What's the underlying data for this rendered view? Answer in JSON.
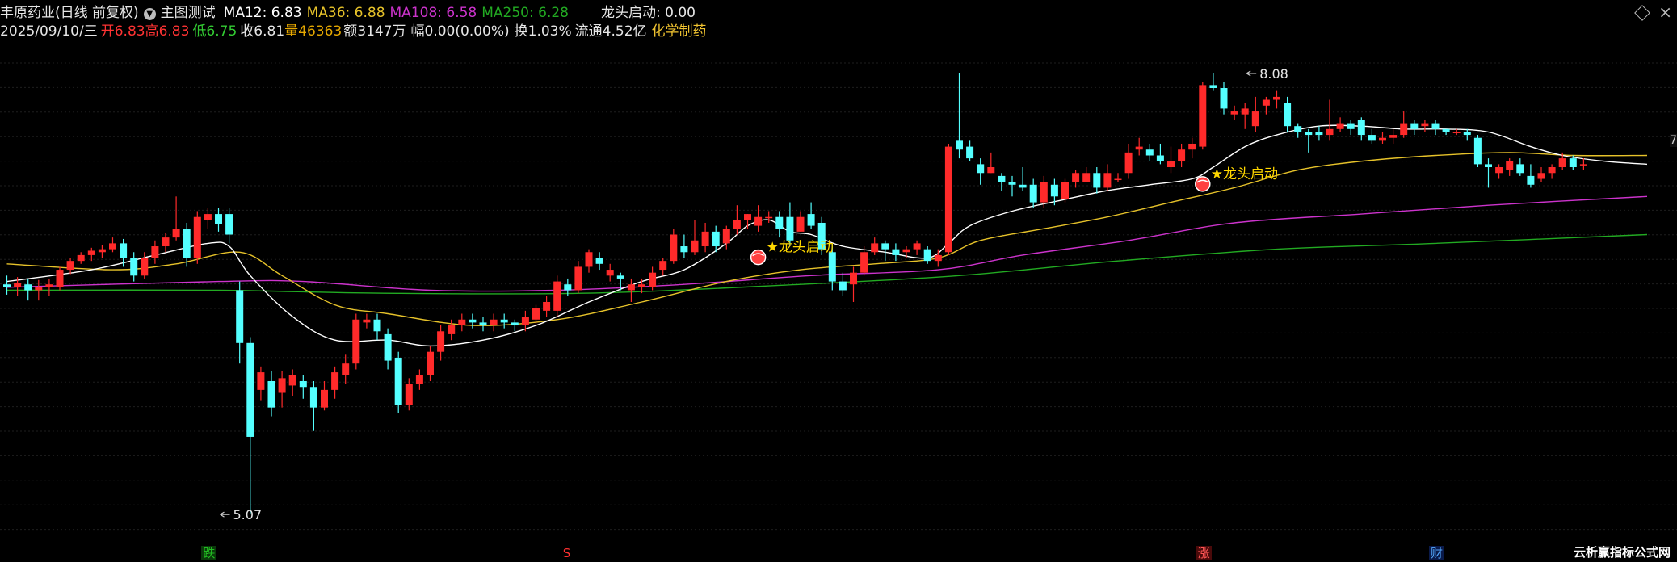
{
  "header": {
    "stock_title": "丰原药业(日线 前复权)",
    "indicator_name": "主图测试",
    "ma12": "MA12: 6.83",
    "ma36": "MA36: 6.88",
    "ma108": "MA108: 6.58",
    "ma250": "MA250: 6.28",
    "signal": "龙头启动: 0.00",
    "date": "2025/09/10/三",
    "open": "开6.83",
    "high": "高6.83",
    "low": "低6.75",
    "close": "收6.81",
    "volume": "量46363",
    "amount": "额3147万",
    "change": "幅0.00(0.00%)",
    "turnover": "换1.03%",
    "float": "流通4.52亿",
    "industry": "化学制药"
  },
  "edge_label": "7",
  "watermark": "云析赢指标公式网",
  "colors": {
    "up": "#ff2a2a",
    "down": "#54ffff",
    "ma12": "#ffffff",
    "ma36": "#e6c22a",
    "ma108": "#cc33cc",
    "ma250": "#22aa22",
    "signal": "#ffd700",
    "neutral": "#e6e6e6",
    "volume": "#e6a800",
    "industry": "#f0c330"
  },
  "chart_data": {
    "type": "candlestick",
    "y_range": [
      4.9,
      8.25
    ],
    "annotations": [
      {
        "text": "8.08",
        "x": 117,
        "y": 8.08
      },
      {
        "text": "5.07",
        "x": 20,
        "y": 5.07
      }
    ],
    "signals": [
      {
        "text": "★龙头启动",
        "x": 71,
        "y": 6.88
      },
      {
        "text": "★龙头启动",
        "x": 113,
        "y": 7.38
      }
    ],
    "bottom_tags": [
      {
        "text": "跌",
        "x": 19,
        "color": "#22bb22",
        "bg": "#0a3a0a"
      },
      {
        "text": "S",
        "x": 53,
        "color": "#ff3030",
        "bg": "#000000"
      },
      {
        "text": "涨",
        "x": 113,
        "color": "#ff5555",
        "bg": "#4a0a0a"
      },
      {
        "text": "财",
        "x": 135,
        "color": "#55aaff",
        "bg": "#0a1a4a"
      }
    ],
    "candles": [
      [
        6.64,
        6.62,
        6.7,
        6.57
      ],
      [
        6.62,
        6.65,
        6.69,
        6.56
      ],
      [
        6.64,
        6.6,
        6.68,
        6.53
      ],
      [
        6.6,
        6.62,
        6.67,
        6.53
      ],
      [
        6.62,
        6.64,
        6.68,
        6.56
      ],
      [
        6.62,
        6.74,
        6.76,
        6.6
      ],
      [
        6.74,
        6.8,
        6.82,
        6.71
      ],
      [
        6.8,
        6.84,
        6.86,
        6.78
      ],
      [
        6.84,
        6.87,
        6.89,
        6.8
      ],
      [
        6.86,
        6.88,
        6.91,
        6.82
      ],
      [
        6.88,
        6.92,
        6.96,
        6.86
      ],
      [
        6.92,
        6.82,
        6.95,
        6.76
      ],
      [
        6.82,
        6.7,
        6.86,
        6.66
      ],
      [
        6.7,
        6.82,
        6.86,
        6.68
      ],
      [
        6.82,
        6.9,
        6.94,
        6.78
      ],
      [
        6.9,
        6.96,
        6.99,
        6.86
      ],
      [
        6.96,
        7.02,
        7.24,
        6.94
      ],
      [
        7.02,
        6.82,
        7.06,
        6.76
      ],
      [
        6.82,
        7.1,
        7.14,
        6.78
      ],
      [
        7.08,
        7.12,
        7.16,
        7.02
      ],
      [
        7.12,
        7.05,
        7.16,
        7.0
      ],
      [
        7.12,
        6.98,
        7.16,
        6.92
      ],
      [
        6.6,
        6.24,
        6.66,
        6.1
      ],
      [
        6.24,
        5.6,
        6.28,
        5.07
      ],
      [
        5.92,
        6.04,
        6.08,
        5.85
      ],
      [
        5.98,
        5.8,
        6.05,
        5.74
      ],
      [
        5.9,
        6.0,
        6.05,
        5.8
      ],
      [
        5.95,
        6.02,
        6.06,
        5.88
      ],
      [
        5.98,
        5.94,
        6.02,
        5.86
      ],
      [
        5.94,
        5.8,
        5.98,
        5.64
      ],
      [
        5.8,
        5.92,
        5.98,
        5.78
      ],
      [
        5.92,
        6.04,
        6.08,
        5.86
      ],
      [
        6.02,
        6.1,
        6.16,
        5.96
      ],
      [
        6.1,
        6.4,
        6.44,
        6.06
      ],
      [
        6.38,
        6.4,
        6.44,
        6.34
      ],
      [
        6.4,
        6.32,
        6.44,
        6.26
      ],
      [
        6.3,
        6.12,
        6.34,
        6.06
      ],
      [
        6.14,
        5.82,
        6.18,
        5.76
      ],
      [
        5.82,
        5.96,
        6.0,
        5.78
      ],
      [
        5.96,
        6.02,
        6.06,
        5.92
      ],
      [
        6.02,
        6.18,
        6.22,
        5.98
      ],
      [
        6.18,
        6.32,
        6.36,
        6.12
      ],
      [
        6.3,
        6.36,
        6.4,
        6.26
      ],
      [
        6.36,
        6.4,
        6.44,
        6.32
      ],
      [
        6.4,
        6.38,
        6.44,
        6.34
      ],
      [
        6.38,
        6.36,
        6.42,
        6.32
      ],
      [
        6.36,
        6.4,
        6.44,
        6.32
      ],
      [
        6.4,
        6.38,
        6.44,
        6.34
      ],
      [
        6.38,
        6.36,
        6.4,
        6.32
      ],
      [
        6.36,
        6.42,
        6.46,
        6.32
      ],
      [
        6.4,
        6.48,
        6.5,
        6.36
      ],
      [
        6.46,
        6.52,
        6.56,
        6.42
      ],
      [
        6.46,
        6.66,
        6.7,
        6.42
      ],
      [
        6.64,
        6.6,
        6.68,
        6.56
      ],
      [
        6.6,
        6.76,
        6.8,
        6.58
      ],
      [
        6.76,
        6.86,
        6.88,
        6.72
      ],
      [
        6.82,
        6.78,
        6.86,
        6.74
      ],
      [
        6.7,
        6.74,
        6.78,
        6.66
      ],
      [
        6.7,
        6.68,
        6.72,
        6.6
      ],
      [
        6.6,
        6.64,
        6.68,
        6.52
      ],
      [
        6.62,
        6.64,
        6.68,
        6.58
      ],
      [
        6.62,
        6.72,
        6.76,
        6.6
      ],
      [
        6.74,
        6.8,
        6.82,
        6.7
      ],
      [
        6.8,
        6.98,
        7.02,
        6.78
      ],
      [
        6.9,
        6.86,
        6.98,
        6.82
      ],
      [
        6.86,
        6.94,
        7.08,
        6.84
      ],
      [
        6.9,
        7.0,
        7.06,
        6.86
      ],
      [
        7.0,
        6.9,
        7.04,
        6.86
      ],
      [
        6.92,
        7.02,
        7.04,
        6.88
      ],
      [
        7.02,
        7.08,
        7.18,
        6.98
      ],
      [
        7.08,
        7.12,
        7.12,
        7.02
      ],
      [
        7.04,
        7.1,
        7.18,
        7.0
      ],
      [
        7.1,
        7.1,
        7.14,
        7.06
      ],
      [
        7.1,
        7.02,
        7.14,
        6.96
      ],
      [
        7.1,
        6.94,
        7.2,
        6.9
      ],
      [
        7.0,
        7.1,
        7.14,
        7.0
      ],
      [
        7.12,
        7.04,
        7.2,
        7.02
      ],
      [
        7.06,
        6.88,
        7.1,
        6.84
      ],
      [
        6.86,
        6.66,
        6.92,
        6.6
      ],
      [
        6.66,
        6.6,
        6.72,
        6.56
      ],
      [
        6.64,
        6.72,
        6.76,
        6.52
      ],
      [
        6.72,
        6.86,
        6.9,
        6.7
      ],
      [
        6.86,
        6.92,
        6.96,
        6.84
      ],
      [
        6.92,
        6.88,
        6.94,
        6.8
      ],
      [
        6.88,
        6.84,
        6.92,
        6.8
      ],
      [
        6.86,
        6.88,
        6.9,
        6.82
      ],
      [
        6.88,
        6.92,
        6.94,
        6.84
      ],
      [
        6.88,
        6.8,
        6.9,
        6.78
      ],
      [
        6.8,
        6.84,
        6.88,
        6.76
      ],
      [
        6.86,
        7.58,
        7.6,
        6.84
      ],
      [
        7.62,
        7.56,
        8.08,
        7.5
      ],
      [
        7.58,
        7.5,
        7.62,
        7.48
      ],
      [
        7.46,
        7.4,
        7.5,
        7.32
      ],
      [
        7.4,
        7.44,
        7.54,
        7.4
      ],
      [
        7.38,
        7.34,
        7.4,
        7.28
      ],
      [
        7.34,
        7.32,
        7.38,
        7.24
      ],
      [
        7.32,
        7.3,
        7.44,
        7.28
      ],
      [
        7.32,
        7.2,
        7.36,
        7.16
      ],
      [
        7.2,
        7.34,
        7.38,
        7.16
      ],
      [
        7.32,
        7.24,
        7.36,
        7.18
      ],
      [
        7.22,
        7.34,
        7.36,
        7.2
      ],
      [
        7.34,
        7.4,
        7.42,
        7.3
      ],
      [
        7.34,
        7.4,
        7.44,
        7.34
      ],
      [
        7.4,
        7.3,
        7.44,
        7.26
      ],
      [
        7.3,
        7.4,
        7.46,
        7.28
      ],
      [
        7.36,
        7.36,
        7.4,
        7.34
      ],
      [
        7.4,
        7.54,
        7.6,
        7.36
      ],
      [
        7.56,
        7.58,
        7.64,
        7.52
      ],
      [
        7.56,
        7.52,
        7.6,
        7.48
      ],
      [
        7.52,
        7.48,
        7.6,
        7.46
      ],
      [
        7.44,
        7.48,
        7.58,
        7.4
      ],
      [
        7.48,
        7.56,
        7.6,
        7.44
      ],
      [
        7.56,
        7.6,
        7.64,
        7.5
      ],
      [
        7.58,
        8.0,
        8.02,
        7.56
      ],
      [
        8.0,
        7.98,
        8.08,
        7.96
      ],
      [
        7.98,
        7.84,
        8.02,
        7.8
      ],
      [
        7.8,
        7.82,
        7.86,
        7.76
      ],
      [
        7.8,
        7.84,
        7.88,
        7.7
      ],
      [
        7.72,
        7.82,
        7.92,
        7.68
      ],
      [
        7.86,
        7.9,
        7.92,
        7.8
      ],
      [
        7.9,
        7.92,
        7.96,
        7.84
      ],
      [
        7.88,
        7.72,
        7.92,
        7.68
      ],
      [
        7.72,
        7.68,
        7.74,
        7.64
      ],
      [
        7.68,
        7.66,
        7.7,
        7.54
      ],
      [
        7.68,
        7.66,
        7.72,
        7.62
      ],
      [
        7.66,
        7.7,
        7.9,
        7.62
      ],
      [
        7.7,
        7.74,
        7.78,
        7.68
      ],
      [
        7.74,
        7.7,
        7.76,
        7.66
      ],
      [
        7.76,
        7.66,
        7.78,
        7.62
      ],
      [
        7.66,
        7.62,
        7.7,
        7.6
      ],
      [
        7.62,
        7.64,
        7.68,
        7.6
      ],
      [
        7.64,
        7.66,
        7.7,
        7.6
      ],
      [
        7.66,
        7.74,
        7.82,
        7.64
      ],
      [
        7.74,
        7.7,
        7.76,
        7.66
      ],
      [
        7.72,
        7.74,
        7.76,
        7.68
      ],
      [
        7.74,
        7.7,
        7.76,
        7.66
      ],
      [
        7.7,
        7.68,
        7.7,
        7.66
      ],
      [
        7.68,
        7.68,
        7.7,
        7.66
      ],
      [
        7.68,
        7.66,
        7.7,
        7.62
      ],
      [
        7.64,
        7.46,
        7.66,
        7.44
      ],
      [
        7.46,
        7.44,
        7.5,
        7.3
      ],
      [
        7.4,
        7.44,
        7.46,
        7.36
      ],
      [
        7.42,
        7.48,
        7.5,
        7.38
      ],
      [
        7.46,
        7.4,
        7.5,
        7.38
      ],
      [
        7.38,
        7.32,
        7.46,
        7.3
      ],
      [
        7.36,
        7.4,
        7.44,
        7.34
      ],
      [
        7.4,
        7.44,
        7.46,
        7.36
      ],
      [
        7.44,
        7.5,
        7.54,
        7.42
      ],
      [
        7.5,
        7.44,
        7.52,
        7.42
      ],
      [
        7.46,
        7.46,
        7.5,
        7.42
      ]
    ],
    "ma12_knots": [
      [
        0,
        6.66
      ],
      [
        8,
        6.74
      ],
      [
        14,
        6.84
      ],
      [
        19,
        6.92
      ],
      [
        21,
        6.9
      ],
      [
        23,
        6.7
      ],
      [
        27,
        6.42
      ],
      [
        31,
        6.26
      ],
      [
        36,
        6.26
      ],
      [
        40,
        6.22
      ],
      [
        45,
        6.26
      ],
      [
        50,
        6.36
      ],
      [
        55,
        6.52
      ],
      [
        60,
        6.66
      ],
      [
        64,
        6.74
      ],
      [
        68,
        6.92
      ],
      [
        70,
        7.04
      ],
      [
        72,
        7.08
      ],
      [
        74,
        7.0
      ],
      [
        76,
        6.98
      ],
      [
        79,
        6.9
      ],
      [
        83,
        6.86
      ],
      [
        87,
        6.82
      ],
      [
        89,
        6.92
      ],
      [
        91,
        7.04
      ],
      [
        95,
        7.14
      ],
      [
        100,
        7.22
      ],
      [
        104,
        7.28
      ],
      [
        108,
        7.32
      ],
      [
        112,
        7.36
      ],
      [
        114,
        7.44
      ],
      [
        117,
        7.58
      ],
      [
        120,
        7.66
      ],
      [
        124,
        7.72
      ],
      [
        128,
        7.72
      ],
      [
        132,
        7.7
      ],
      [
        136,
        7.7
      ],
      [
        140,
        7.68
      ],
      [
        144,
        7.58
      ],
      [
        147,
        7.52
      ],
      [
        151,
        7.48
      ],
      [
        155,
        7.46
      ]
    ],
    "ma36_knots": [
      [
        0,
        6.78
      ],
      [
        10,
        6.74
      ],
      [
        16,
        6.78
      ],
      [
        22,
        6.86
      ],
      [
        26,
        6.7
      ],
      [
        31,
        6.5
      ],
      [
        36,
        6.44
      ],
      [
        44,
        6.36
      ],
      [
        52,
        6.4
      ],
      [
        60,
        6.52
      ],
      [
        68,
        6.66
      ],
      [
        75,
        6.74
      ],
      [
        82,
        6.78
      ],
      [
        88,
        6.82
      ],
      [
        92,
        6.94
      ],
      [
        98,
        7.02
      ],
      [
        104,
        7.1
      ],
      [
        110,
        7.2
      ],
      [
        116,
        7.3
      ],
      [
        122,
        7.42
      ],
      [
        128,
        7.48
      ],
      [
        135,
        7.52
      ],
      [
        142,
        7.54
      ],
      [
        148,
        7.52
      ],
      [
        155,
        7.52
      ]
    ],
    "ma108_knots": [
      [
        0,
        6.62
      ],
      [
        20,
        6.66
      ],
      [
        28,
        6.66
      ],
      [
        40,
        6.6
      ],
      [
        52,
        6.6
      ],
      [
        64,
        6.64
      ],
      [
        76,
        6.7
      ],
      [
        88,
        6.74
      ],
      [
        96,
        6.84
      ],
      [
        106,
        6.94
      ],
      [
        116,
        7.06
      ],
      [
        128,
        7.12
      ],
      [
        140,
        7.18
      ],
      [
        155,
        7.24
      ]
    ],
    "ma250_knots": [
      [
        0,
        6.6
      ],
      [
        20,
        6.6
      ],
      [
        35,
        6.58
      ],
      [
        55,
        6.58
      ],
      [
        75,
        6.64
      ],
      [
        90,
        6.7
      ],
      [
        105,
        6.8
      ],
      [
        120,
        6.88
      ],
      [
        135,
        6.92
      ],
      [
        155,
        6.98
      ]
    ]
  }
}
